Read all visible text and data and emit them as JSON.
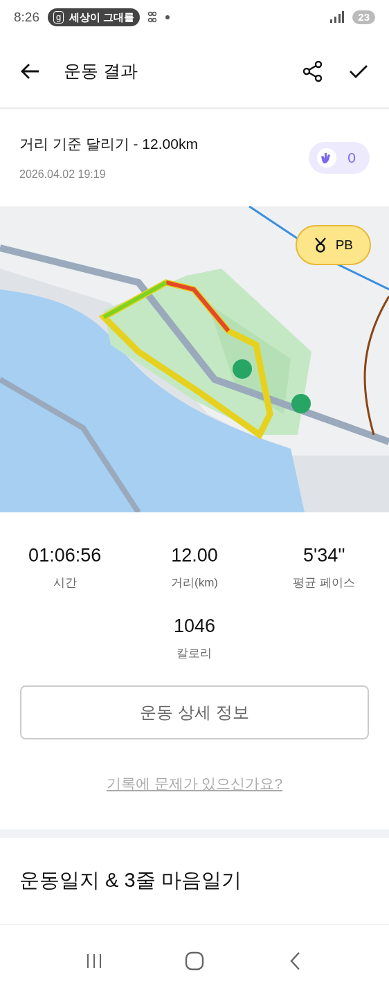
{
  "status_bar": {
    "time": "8:26",
    "notification": {
      "app_letter": "g",
      "text": "세상이 그대를"
    },
    "battery": "23"
  },
  "header": {
    "title": "운동 결과"
  },
  "workout": {
    "title": "거리 기준 달리기 - 12.00km",
    "date": "2026.04.02 19:19",
    "claps": "0"
  },
  "map": {
    "kind": "picture",
    "badge": "PB"
  },
  "stats": [
    {
      "value": "01:06:56",
      "label": "시간"
    },
    {
      "value": "12.00",
      "label": "거리(km)"
    },
    {
      "value": "5'34''",
      "label": "평균 페이스"
    },
    {
      "value": "1046",
      "label": "칼로리"
    }
  ],
  "detail_button": "운동 상세 정보",
  "report_link": "기록에 문제가 있으신가요?",
  "journal": {
    "title": "운동일지 & 3줄 마음일기"
  }
}
